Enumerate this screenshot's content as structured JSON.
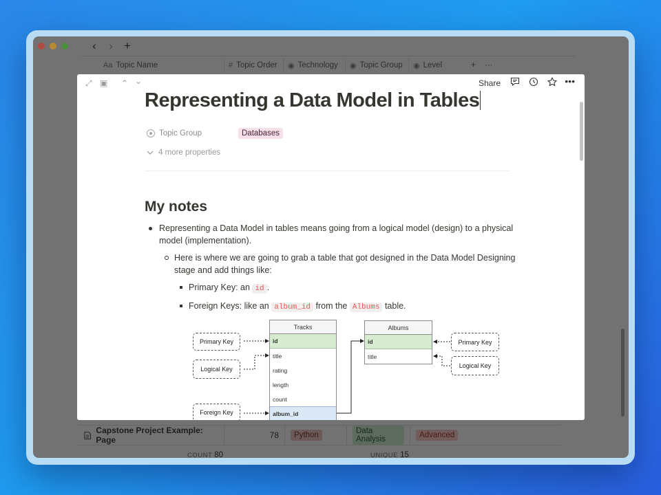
{
  "table_header": {
    "columns": [
      {
        "icon": "Aa",
        "label": "Topic Name"
      },
      {
        "icon": "#",
        "label": "Topic Order"
      },
      {
        "icon": "◉",
        "label": "Technology"
      },
      {
        "icon": "◉",
        "label": "Topic Group"
      },
      {
        "icon": "◉",
        "label": "Level"
      }
    ],
    "add": "+",
    "more": "···"
  },
  "nav": {
    "back": "‹",
    "forward": "›",
    "new_tab": "+"
  },
  "page": {
    "share": "Share",
    "title": "Representing a Data Model in Tables",
    "property_label": "Topic Group",
    "property_value": "Databases",
    "more_properties": "4 more properties",
    "heading": "My notes",
    "bullet1": "Representing a Data Model in tables means going from a logical model (design) to a physical model (implementation).",
    "bullet2": "Here is where we are going to grab a table that got designed in the Data Model Designing stage and add things like:",
    "bullet3_prefix": "Primary Key: an",
    "bullet3_code": "id",
    "bullet3_suffix": ".",
    "bullet4_prefix": "Foreign Keys: like an",
    "bullet4_code1": "album_id",
    "bullet4_mid": "from the",
    "bullet4_code2": "Albums",
    "bullet4_suffix": "table."
  },
  "diagram": {
    "tracks": {
      "title": "Tracks",
      "rows": [
        "id",
        "title",
        "rating",
        "length",
        "count",
        "album_id"
      ]
    },
    "albums": {
      "title": "Albums",
      "rows": [
        "id",
        "title"
      ]
    },
    "labels": {
      "left_primary": "Primary Key",
      "left_logical": "Logical Key",
      "left_foreign": "Foreign Key",
      "right_primary": "Primary Key",
      "right_logical": "Logical Key"
    }
  },
  "bottom_row": {
    "name": "Capstone Project Example: Page",
    "order": "78",
    "technology": "Python",
    "group": "Data Analysis",
    "level": "Advanced"
  },
  "footer": {
    "count_label": "COUNT",
    "count_value": "80",
    "unique_label": "UNIQUE",
    "unique_value": "15"
  }
}
